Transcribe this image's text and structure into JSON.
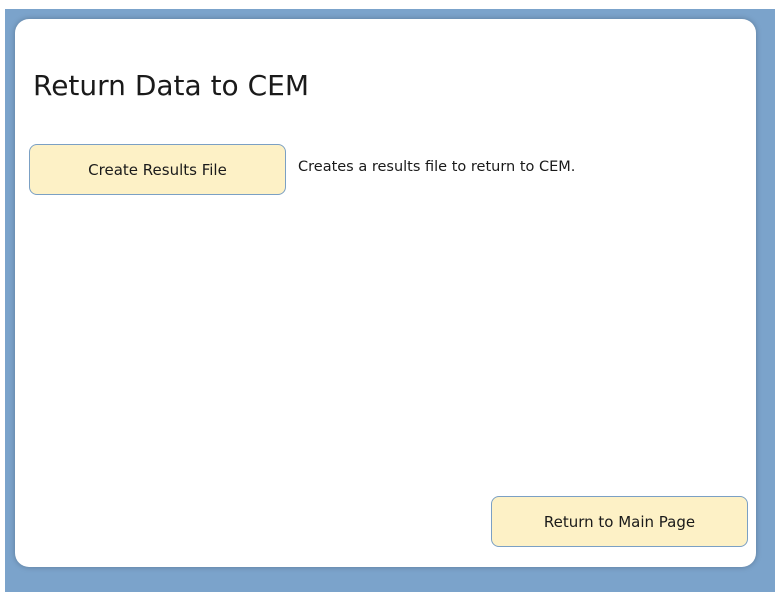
{
  "page": {
    "title": "Return Data to CEM"
  },
  "actions": {
    "create_results_label": "Create Results File",
    "create_results_description": "Creates a results file to return to CEM.",
    "return_main_label": "Return to Main Page"
  },
  "colors": {
    "frame_border": "#7ba3cb",
    "button_fill": "#fdf1c6",
    "button_border": "#7ba0c4",
    "panel_background": "#ffffff"
  }
}
